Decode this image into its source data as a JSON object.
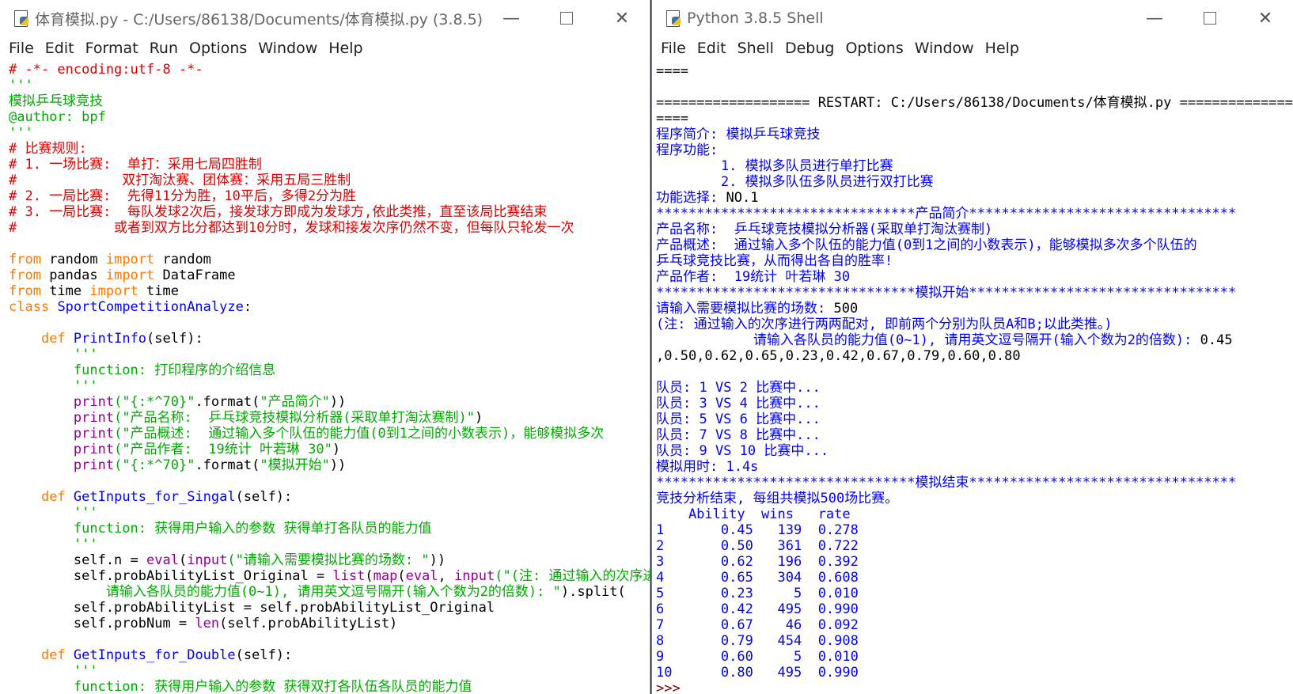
{
  "editor": {
    "title": "体育模拟.py - C:/Users/86138/Documents/体育模拟.py (3.8.5)",
    "menu": [
      "File",
      "Edit",
      "Format",
      "Run",
      "Options",
      "Window",
      "Help"
    ],
    "lines": [
      [
        {
          "c": "com",
          "t": "# -*- encoding:utf-8 -*-"
        }
      ],
      [
        {
          "c": "str",
          "t": "'''"
        }
      ],
      [
        {
          "c": "str",
          "t": "模拟乒乓球竞技"
        }
      ],
      [
        {
          "c": "str",
          "t": "@author: bpf"
        }
      ],
      [
        {
          "c": "str",
          "t": "'''"
        }
      ],
      [
        {
          "c": "com",
          "t": "# 比赛规则:"
        }
      ],
      [
        {
          "c": "com",
          "t": "# 1. 一场比赛:  单打：采用七局四胜制"
        }
      ],
      [
        {
          "c": "com",
          "t": "#             双打淘汰赛、团体赛：采用五局三胜制"
        }
      ],
      [
        {
          "c": "com",
          "t": "# 2. 一局比赛:  先得11分为胜，10平后，多得2分为胜"
        }
      ],
      [
        {
          "c": "com",
          "t": "# 3. 一局比赛:  每队发球2次后，接发球方即成为发球方,依此类推，直至该局比赛结束"
        }
      ],
      [
        {
          "c": "com",
          "t": "#            或者到双方比分都达到10分时，发球和接发次序仍然不变，但每队只轮发一次"
        }
      ],
      [],
      [
        {
          "c": "kw",
          "t": "from"
        },
        {
          "c": "nm",
          "t": " random "
        },
        {
          "c": "kw",
          "t": "import"
        },
        {
          "c": "nm",
          "t": " random"
        }
      ],
      [
        {
          "c": "kw",
          "t": "from"
        },
        {
          "c": "nm",
          "t": " pandas "
        },
        {
          "c": "kw",
          "t": "import"
        },
        {
          "c": "nm",
          "t": " DataFrame"
        }
      ],
      [
        {
          "c": "kw",
          "t": "from"
        },
        {
          "c": "nm",
          "t": " time "
        },
        {
          "c": "kw",
          "t": "import"
        },
        {
          "c": "nm",
          "t": " time"
        }
      ],
      [
        {
          "c": "kw",
          "t": "class"
        },
        {
          "c": "nm",
          "t": " "
        },
        {
          "c": "def",
          "t": "SportCompetitionAnalyze"
        },
        {
          "c": "nm",
          "t": ":"
        }
      ],
      [],
      [
        {
          "c": "nm",
          "t": "    "
        },
        {
          "c": "kw",
          "t": "def"
        },
        {
          "c": "nm",
          "t": " "
        },
        {
          "c": "def",
          "t": "PrintInfo"
        },
        {
          "c": "nm",
          "t": "(self):"
        }
      ],
      [
        {
          "c": "str",
          "t": "        '''"
        }
      ],
      [
        {
          "c": "str",
          "t": "        function: 打印程序的介绍信息"
        }
      ],
      [
        {
          "c": "str",
          "t": "        '''"
        }
      ],
      [
        {
          "c": "nm",
          "t": "        "
        },
        {
          "c": "bi",
          "t": "print"
        },
        {
          "c": "str",
          "t": "(\"{:*^70}\""
        },
        {
          "c": "nm",
          "t": ".format("
        },
        {
          "c": "str",
          "t": "\"产品简介\""
        },
        {
          "c": "nm",
          "t": "))"
        }
      ],
      [
        {
          "c": "nm",
          "t": "        "
        },
        {
          "c": "bi",
          "t": "print"
        },
        {
          "c": "str",
          "t": "(\"产品名称:  乒乓球竞技模拟分析器(采取单打淘汰赛制)\""
        },
        {
          "c": "nm",
          "t": ")"
        }
      ],
      [
        {
          "c": "nm",
          "t": "        "
        },
        {
          "c": "bi",
          "t": "print"
        },
        {
          "c": "str",
          "t": "(\"产品概述:  通过输入多个队伍的能力值(0到1之间的小数表示)，能够模拟多次"
        }
      ],
      [
        {
          "c": "nm",
          "t": "        "
        },
        {
          "c": "bi",
          "t": "print"
        },
        {
          "c": "str",
          "t": "(\"产品作者:  19统计 叶若琳 30\""
        },
        {
          "c": "nm",
          "t": ")"
        }
      ],
      [
        {
          "c": "nm",
          "t": "        "
        },
        {
          "c": "bi",
          "t": "print"
        },
        {
          "c": "str",
          "t": "(\"{:*^70}\""
        },
        {
          "c": "nm",
          "t": ".format("
        },
        {
          "c": "str",
          "t": "\"模拟开始\""
        },
        {
          "c": "nm",
          "t": "))"
        }
      ],
      [],
      [
        {
          "c": "nm",
          "t": "    "
        },
        {
          "c": "kw",
          "t": "def"
        },
        {
          "c": "nm",
          "t": " "
        },
        {
          "c": "def",
          "t": "GetInputs_for_Singal"
        },
        {
          "c": "nm",
          "t": "(self):"
        }
      ],
      [
        {
          "c": "str",
          "t": "        '''"
        }
      ],
      [
        {
          "c": "str",
          "t": "        function: 获得用户输入的参数 获得单打各队员的能力值"
        }
      ],
      [
        {
          "c": "str",
          "t": "        '''"
        }
      ],
      [
        {
          "c": "nm",
          "t": "        self.n = "
        },
        {
          "c": "bi",
          "t": "eval"
        },
        {
          "c": "nm",
          "t": "("
        },
        {
          "c": "bi",
          "t": "input"
        },
        {
          "c": "str",
          "t": "(\"请输入需要模拟比赛的场数: \""
        },
        {
          "c": "nm",
          "t": "))"
        }
      ],
      [
        {
          "c": "nm",
          "t": "        self.probAbilityList_Original = "
        },
        {
          "c": "bi",
          "t": "list"
        },
        {
          "c": "nm",
          "t": "("
        },
        {
          "c": "bi",
          "t": "map"
        },
        {
          "c": "nm",
          "t": "("
        },
        {
          "c": "bi",
          "t": "eval"
        },
        {
          "c": "nm",
          "t": ", "
        },
        {
          "c": "bi",
          "t": "input"
        },
        {
          "c": "str",
          "t": "(\"(注: 通过输入的次序进行两两配对"
        }
      ],
      [
        {
          "c": "str",
          "t": "            请输入各队员的能力值(0~1), 请用英文逗号隔开(输入个数为2的倍数): \""
        },
        {
          "c": "nm",
          "t": ").split("
        }
      ],
      [
        {
          "c": "nm",
          "t": "        self.probAbilityList = self.probAbilityList_Original"
        }
      ],
      [
        {
          "c": "nm",
          "t": "        self.probNum = "
        },
        {
          "c": "bi",
          "t": "len"
        },
        {
          "c": "nm",
          "t": "(self.probAbilityList)"
        }
      ],
      [],
      [
        {
          "c": "nm",
          "t": "    "
        },
        {
          "c": "kw",
          "t": "def"
        },
        {
          "c": "nm",
          "t": " "
        },
        {
          "c": "def",
          "t": "GetInputs_for_Double"
        },
        {
          "c": "nm",
          "t": "(self):"
        }
      ],
      [
        {
          "c": "str",
          "t": "        '''"
        }
      ],
      [
        {
          "c": "str",
          "t": "        function: 获得用户输入的参数 获得双打各队伍各队员的能力值"
        }
      ],
      [
        {
          "c": "str",
          "t": "        '''"
        }
      ]
    ]
  },
  "shell": {
    "title": "Python 3.8.5 Shell",
    "menu": [
      "File",
      "Edit",
      "Shell",
      "Debug",
      "Options",
      "Window",
      "Help"
    ],
    "lines": [
      [
        {
          "c": "res",
          "t": "===="
        }
      ],
      [],
      [
        {
          "c": "res",
          "t": "=================== RESTART: C:/Users/86138/Documents/体育模拟.py =============="
        }
      ],
      [
        {
          "c": "res",
          "t": "===="
        }
      ],
      [
        {
          "c": "out",
          "t": "程序简介: 模拟乒乓球竞技"
        }
      ],
      [
        {
          "c": "out",
          "t": "程序功能:"
        }
      ],
      [
        {
          "c": "out",
          "t": "        1. 模拟多队员进行单打比赛"
        }
      ],
      [
        {
          "c": "out",
          "t": "        2. 模拟多队伍多队员进行双打比赛"
        }
      ],
      [
        {
          "c": "out",
          "t": "功能选择: "
        },
        {
          "c": "res",
          "t": "NO.1"
        }
      ],
      [
        {
          "c": "out",
          "t": "********************************产品简介*********************************"
        }
      ],
      [
        {
          "c": "out",
          "t": "产品名称:  乒乓球竞技模拟分析器(采取单打淘汰赛制)"
        }
      ],
      [
        {
          "c": "out",
          "t": "产品概述:  通过输入多个队伍的能力值(0到1之间的小数表示)，能够模拟多次多个队伍的"
        }
      ],
      [
        {
          "c": "out",
          "t": "乒乓球竞技比赛，从而得出各自的胜率!"
        }
      ],
      [
        {
          "c": "out",
          "t": "产品作者:  19统计 叶若琳 30"
        }
      ],
      [
        {
          "c": "out",
          "t": "********************************模拟开始*********************************"
        }
      ],
      [
        {
          "c": "out",
          "t": "请输入需要模拟比赛的场数: "
        },
        {
          "c": "res",
          "t": "500"
        }
      ],
      [
        {
          "c": "out",
          "t": "(注: 通过输入的次序进行两两配对, 即前两个分别为队员A和B;以此类推。)"
        }
      ],
      [
        {
          "c": "out",
          "t": "            请输入各队员的能力值(0~1), 请用英文逗号隔开(输入个数为2的倍数): "
        },
        {
          "c": "res",
          "t": "0.45"
        }
      ],
      [
        {
          "c": "res",
          "t": ",0.50,0.62,0.65,0.23,0.42,0.67,0.79,0.60,0.80"
        }
      ],
      [],
      [
        {
          "c": "out",
          "t": "队员: 1 VS 2 比赛中..."
        }
      ],
      [
        {
          "c": "out",
          "t": "队员: 3 VS 4 比赛中..."
        }
      ],
      [
        {
          "c": "out",
          "t": "队员: 5 VS 6 比赛中..."
        }
      ],
      [
        {
          "c": "out",
          "t": "队员: 7 VS 8 比赛中..."
        }
      ],
      [
        {
          "c": "out",
          "t": "队员: 9 VS 10 比赛中..."
        }
      ],
      [
        {
          "c": "out",
          "t": "模拟用时: 1.4s"
        }
      ],
      [
        {
          "c": "out",
          "t": "********************************模拟结束*********************************"
        }
      ],
      [
        {
          "c": "out",
          "t": "竞技分析结束, 每组共模拟500场比赛。"
        }
      ],
      [
        {
          "c": "out",
          "t": "    Ability  wins   rate"
        }
      ],
      [
        {
          "c": "out",
          "t": "1       0.45   139  0.278"
        }
      ],
      [
        {
          "c": "out",
          "t": "2       0.50   361  0.722"
        }
      ],
      [
        {
          "c": "out",
          "t": "3       0.62   196  0.392"
        }
      ],
      [
        {
          "c": "out",
          "t": "4       0.65   304  0.608"
        }
      ],
      [
        {
          "c": "out",
          "t": "5       0.23     5  0.010"
        }
      ],
      [
        {
          "c": "out",
          "t": "6       0.42   495  0.990"
        }
      ],
      [
        {
          "c": "out",
          "t": "7       0.67    46  0.092"
        }
      ],
      [
        {
          "c": "out",
          "t": "8       0.79   454  0.908"
        }
      ],
      [
        {
          "c": "out",
          "t": "9       0.60     5  0.010"
        }
      ],
      [
        {
          "c": "out",
          "t": "10      0.80   495  0.990"
        }
      ],
      [
        {
          "c": "shell",
          "t": ">>> "
        }
      ]
    ]
  }
}
